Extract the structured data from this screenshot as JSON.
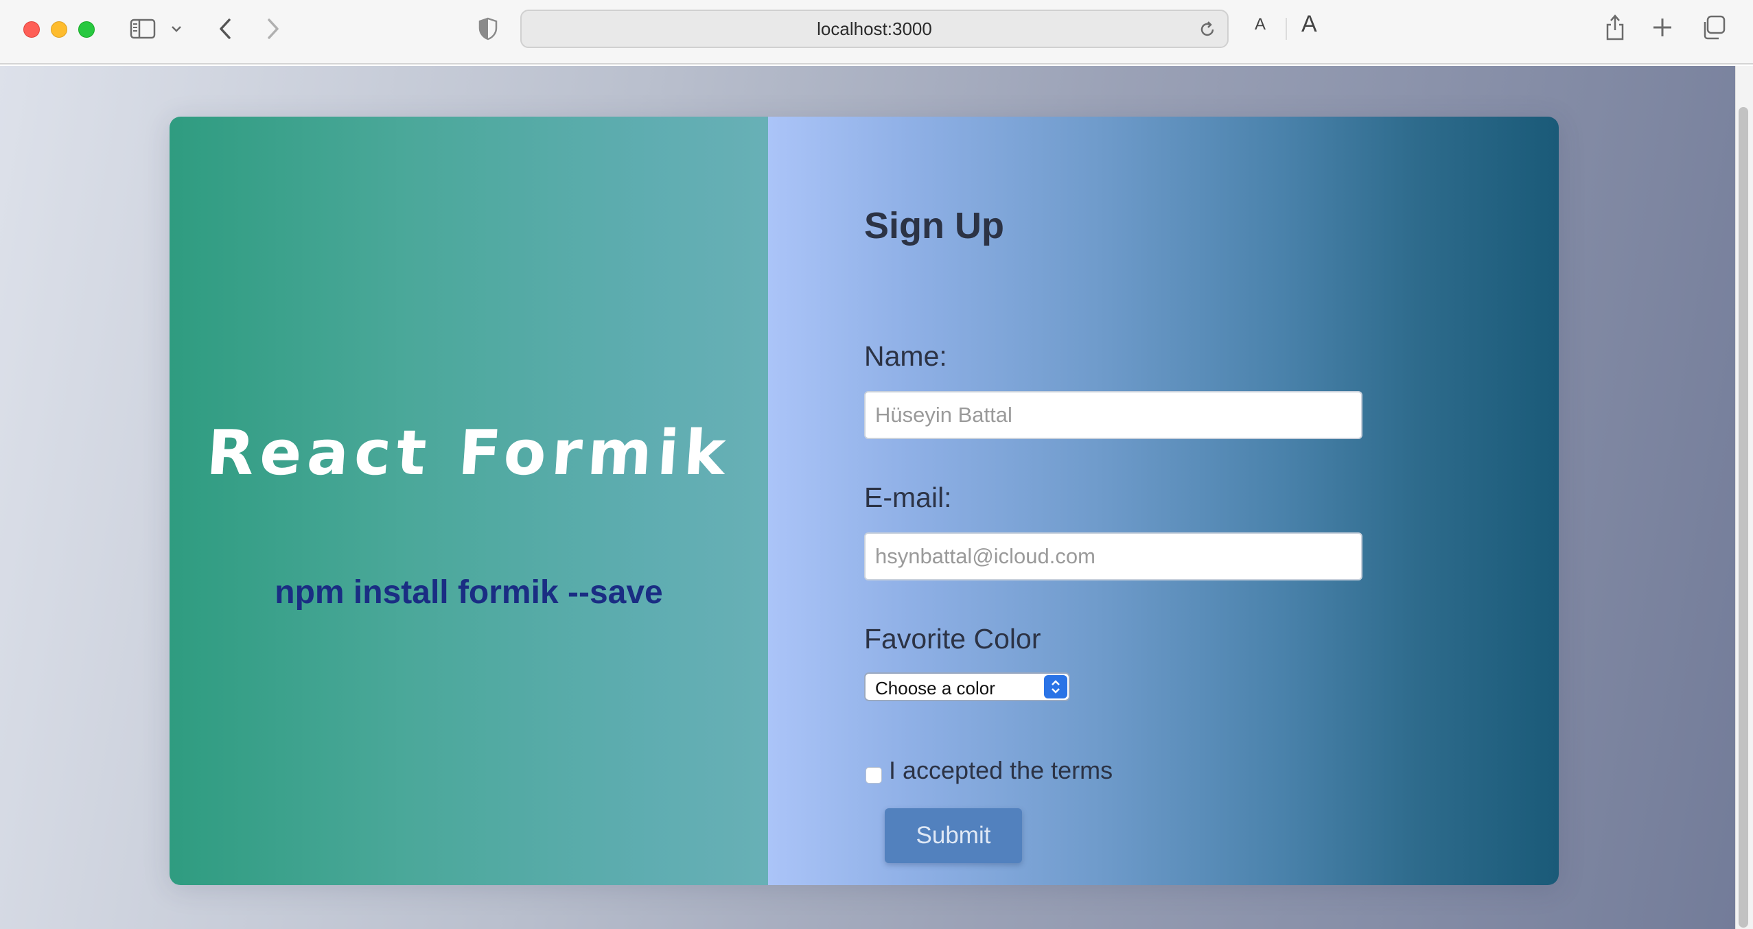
{
  "browser": {
    "url": "localhost:3000",
    "font_small_label": "A",
    "font_large_label": "A",
    "icons": [
      "sidebar-icon",
      "chevron-down-icon",
      "back-arrow-icon",
      "forward-arrow-icon",
      "privacy-shield-icon",
      "reload-icon",
      "share-icon",
      "new-tab-plus-icon",
      "tab-overview-icon"
    ]
  },
  "left_panel": {
    "title": "React Formik",
    "install_command": "npm install formik --save"
  },
  "form": {
    "title": "Sign Up",
    "name_label": "Name:",
    "name_placeholder": "Hüseyin Battal",
    "email_label": "E-mail:",
    "email_placeholder": "hsynbattal@icloud.com",
    "color_label": "Favorite Color",
    "color_select_value": "Choose a color",
    "terms_label": "I accepted the terms",
    "terms_checked": false,
    "submit_label": "Submit"
  },
  "colors": {
    "left_panel_start": "#2f9c80",
    "left_panel_end": "#68b0b6",
    "right_panel_start": "#abc4f8",
    "right_panel_end": "#1a5a78",
    "install_text": "#1a2d83",
    "submit_button": "#5281be"
  }
}
